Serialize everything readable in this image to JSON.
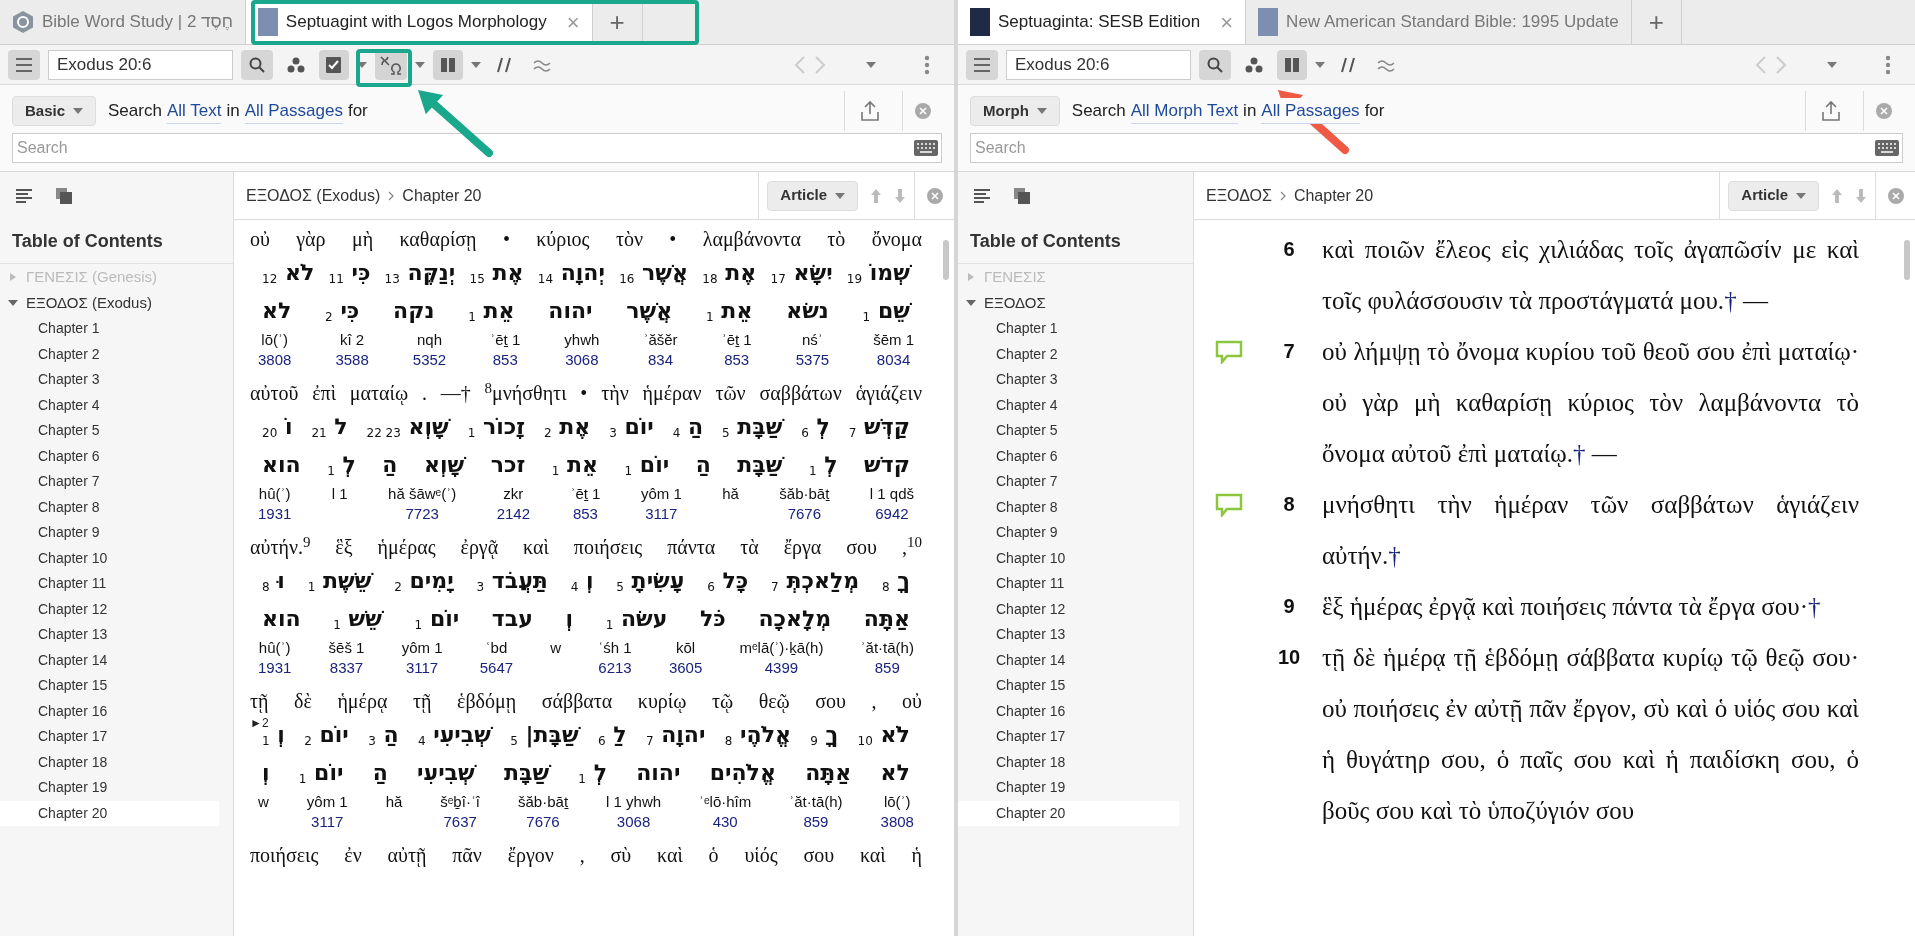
{
  "panes": [
    {
      "kind": "interlinear",
      "tabs": [
        {
          "kind": "home",
          "label": "Bible Word Study | 2 חֶסֶד",
          "selected": false
        },
        {
          "kind": "book",
          "label": "Septuagint with Logos Morphology",
          "selected": true,
          "close": "×"
        },
        {
          "kind": "add",
          "label": "+",
          "selected": false
        }
      ],
      "reference": "Exodus 20:6",
      "tools": [
        {
          "kind": "visual-filter",
          "on": false
        },
        {
          "kind": "highlight",
          "on": true
        },
        {
          "kind": "interlinear",
          "on": true
        },
        {
          "kind": "columns",
          "on": true
        },
        {
          "kind": "parallel",
          "on": false
        },
        {
          "kind": "inline",
          "on": false
        }
      ],
      "search": {
        "mode": "Basic",
        "prefix": "Search",
        "scope": "All Text",
        "joiner": "in",
        "range": "All Passages",
        "suffix": "for",
        "placeholder": "Search"
      },
      "toc": {
        "title": "Table of Contents",
        "books": [
          {
            "label": "ΓΕΝΕΣΙΣ (Genesis)",
            "expanded": false
          },
          {
            "label": "ΕΞΟΔΟΣ (Exodus)",
            "expanded": true,
            "children": [
              {
                "label": "Chapter 1",
                "selected": false
              },
              {
                "label": "Chapter 2",
                "selected": false
              },
              {
                "label": "Chapter 3",
                "selected": false
              },
              {
                "label": "Chapter 4",
                "selected": false
              },
              {
                "label": "Chapter 5",
                "selected": false
              },
              {
                "label": "Chapter 6",
                "selected": false
              },
              {
                "label": "Chapter 7",
                "selected": false
              },
              {
                "label": "Chapter 8",
                "selected": false
              },
              {
                "label": "Chapter 9",
                "selected": false
              },
              {
                "label": "Chapter 10",
                "selected": false
              },
              {
                "label": "Chapter 11",
                "selected": false
              },
              {
                "label": "Chapter 12",
                "selected": false
              },
              {
                "label": "Chapter 13",
                "selected": false
              },
              {
                "label": "Chapter 14",
                "selected": false
              },
              {
                "label": "Chapter 15",
                "selected": false
              },
              {
                "label": "Chapter 16",
                "selected": false
              },
              {
                "label": "Chapter 17",
                "selected": false
              },
              {
                "label": "Chapter 18",
                "selected": false
              },
              {
                "label": "Chapter 19",
                "selected": false
              },
              {
                "label": "Chapter 20",
                "selected": true
              }
            ]
          }
        ]
      },
      "breadcrumb": [
        "ΕΞΟΔΟΣ (Exodus)",
        "Chapter 20"
      ],
      "view_button": "Article",
      "blocks": [
        {
          "greek": [
            "οὐ",
            "γὰρ",
            "μὴ",
            "καθαρίσῃ",
            "•",
            "κύριος",
            "τὸν",
            "•",
            "λαμβάνοντα",
            "τὸ",
            "ὄνομα"
          ],
          "hebrew": [
            "שְׁמוֹ $_{19}$",
            "יִשָּׂא $_{17}$",
            "אֶת $_{18}$",
            "אֲשֶׁר $_{16}$",
            "יְהוָה $_{14}$",
            "אֶת $_{15}$",
            "יְנַקֶּה $_{13}$",
            "כִּי $_{11}$",
            "לֹא $_{12}$"
          ],
          "lemma": [
            "שֵׁם $_{1}$",
            "נשׂא",
            "אֵת $_{1}$",
            "אֲשֶׁר",
            "יהוה",
            "אֵת $_{1}$",
            "נקה",
            "כִּי $_{2}$",
            "לא"
          ],
          "words": [
            {
              "t": "lō(ʾ)",
              "s": "3808"
            },
            {
              "t": "kî 2",
              "s": "3588"
            },
            {
              "t": "nqh",
              "s": "5352"
            },
            {
              "t": "ʾēṯ 1",
              "s": "853"
            },
            {
              "t": "yhwh",
              "s": "3068"
            },
            {
              "t": "ʾăšĕr",
              "s": "834"
            },
            {
              "t": "ʾēṯ 1",
              "s": "853"
            },
            {
              "t": "nśʾ",
              "s": "5375"
            },
            {
              "t": "šēm 1",
              "s": "8034"
            }
          ]
        },
        {
          "greek": [
            "αὐτοῦ",
            "ἐπὶ",
            "ματαίῳ",
            ".",
            "—†",
            "$^{8}$μνήσθητι",
            "•",
            "τὴν",
            "ἡμέραν",
            "τῶν",
            "σαββάτων",
            "ἁγιάζειν"
          ],
          "hebrew": [
            "קַדְּשׁ $_{7}$",
            "לְ $_{6}$",
            "שַׁבָּת $_{5}$",
            "הַ $_{4}$",
            "יוֹם $_{3}$",
            "אֶת $_{2}$",
            "זָכוֹר $_{1}$",
            "שָׁוְא $_{23 22}$",
            "ל $_{21}$",
            "וֹ $_{20}$"
          ],
          "lemma": [
            "קדשׁ",
            "לְ $_{1}$",
            "שַׁבָּת",
            "הַ",
            "יוֹם $_{1}$",
            "אֵת $_{1}$",
            "זכר",
            "שָׁוְא",
            "הַ",
            "לְ $_{1}$",
            "הוא"
          ],
          "words": [
            {
              "t": "hû(ʾ)",
              "s": "1931"
            },
            {
              "t": "l 1"
            },
            {
              "t": "hă šāwᵉ(ʾ)",
              "s": "7723"
            },
            {
              "t": "zkr",
              "s": "2142"
            },
            {
              "t": "ʾēṯ 1",
              "s": "853"
            },
            {
              "t": "yôm 1",
              "s": "3117"
            },
            {
              "t": "hă"
            },
            {
              "t": "šăb·bāṯ",
              "s": "7676"
            },
            {
              "t": "l 1 qdš",
              "s": "6942"
            }
          ]
        },
        {
          "greek": [
            "αὐτήν.$^{9}$",
            "ἓξ",
            "ἡμέρας",
            "ἐργᾷ",
            "καὶ",
            "ποιήσεις",
            "πάντα",
            "τὰ",
            "ἔργα",
            "σου",
            ",$^{10}$"
          ],
          "hebrew": [
            "ךָ $_{8}$",
            "מְלַאכְתְּ $_{7}$",
            "כָּל $_{6}$",
            "עָשִׂיתָ $_{5}$",
            "וְ $_{4}$",
            "תַּעֲבֹד $_{3}$",
            "יָמִים $_{2}$",
            "שֵׁשֶׁת $_{1}$",
            "וּ $_{8}$"
          ],
          "lemma": [
            "אַתָּה",
            "מְלָאכָה",
            "כֹּל",
            "עשׂה $_{1}$",
            "וְ",
            "עבד",
            "יוֹם $_{1}$",
            "שֵׁשׁ $_{1}$",
            "הוא"
          ],
          "words": [
            {
              "t": "hû(ʾ)",
              "s": "1931"
            },
            {
              "t": "šēš 1",
              "s": "8337"
            },
            {
              "t": "yôm 1",
              "s": "3117"
            },
            {
              "t": "ʿbd",
              "s": "5647"
            },
            {
              "t": "w"
            },
            {
              "t": "ʿśh 1",
              "s": "6213"
            },
            {
              "t": "kōl",
              "s": "3605"
            },
            {
              "t": "mᵉlā(ʾ)·ḵā(h)",
              "s": "4399"
            },
            {
              "t": "ʾăt·tā(h)",
              "s": "859"
            }
          ]
        },
        {
          "marker": "►2",
          "greek": [
            "τῇ",
            "δὲ",
            "ἡμέρᾳ",
            "τῇ",
            "ἑβδόμῃ",
            "σάββατα",
            "κυρίῳ",
            "τῷ",
            "θεῷ",
            "σου",
            ",",
            "οὐ"
          ],
          "hebrew": [
            "לֹא $_{10}$",
            "ךָ $_{9}$",
            "אֱלֹהֶי $_{8}$",
            "יהוָה $_{7}$",
            "לַ $_{6}$",
            "שַׁבָּת| $_{5}$",
            "שְׁבִיעִי $_{4}$",
            "הַ $_{3}$",
            "יוֹם $_{2}$",
            "וְ $_{1}$"
          ],
          "lemma": [
            "לא",
            "אַתָּה",
            "אֱלֹהִים",
            "יהוה",
            "לְ $_{1}$",
            "שַׁבָּת",
            "שְׁבִיעִי",
            "הַ",
            "יוֹם $_{1}$",
            "וְ"
          ],
          "words": [
            {
              "t": "w"
            },
            {
              "t": "yôm 1",
              "s": "3117"
            },
            {
              "t": "hă"
            },
            {
              "t": "šᵉḇî·ʿî",
              "s": "7637"
            },
            {
              "t": "šăb·bāṯ",
              "s": "7676"
            },
            {
              "t": "l 1 yhwh",
              "s": "3068"
            },
            {
              "t": "ʾᵉlō·hîm",
              "s": "430"
            },
            {
              "t": "ʾăt·tā(h)",
              "s": "859"
            },
            {
              "t": "lō(ʾ)",
              "s": "3808"
            }
          ]
        },
        {
          "greek": [
            "ποιήσεις",
            "ἐν",
            "αὐτῇ",
            "πᾶν",
            "ἔργον",
            ",",
            "σὺ",
            "καὶ",
            "ὁ",
            "υἱός",
            "σου",
            "καὶ",
            "ἡ"
          ]
        }
      ]
    },
    {
      "kind": "reader",
      "tabs": [
        {
          "kind": "book",
          "label": "Septuaginta: SESB Edition",
          "selected": true,
          "close": "×"
        },
        {
          "kind": "book",
          "label": "New American Standard Bible: 1995 Update",
          "selected": false
        },
        {
          "kind": "add",
          "label": "+",
          "selected": false
        }
      ],
      "reference": "Exodus 20:6",
      "tools": [
        {
          "kind": "visual-filter",
          "on": false
        },
        {
          "kind": "columns",
          "on": true
        },
        {
          "kind": "parallel",
          "on": false
        },
        {
          "kind": "inline",
          "on": false
        }
      ],
      "search": {
        "mode": "Morph",
        "prefix": "Search",
        "scope": "All Morph Text",
        "joiner": "in",
        "range": "All Passages",
        "suffix": "for",
        "placeholder": "Search"
      },
      "toc": {
        "title": "Table of Contents",
        "books": [
          {
            "label": "ΓΕΝΕΣΙΣ",
            "expanded": false
          },
          {
            "label": "ΕΞΟΔΟΣ",
            "expanded": true,
            "children": [
              {
                "label": "Chapter 1",
                "selected": false
              },
              {
                "label": "Chapter 2",
                "selected": false
              },
              {
                "label": "Chapter 3",
                "selected": false
              },
              {
                "label": "Chapter 4",
                "selected": false
              },
              {
                "label": "Chapter 5",
                "selected": false
              },
              {
                "label": "Chapter 6",
                "selected": false
              },
              {
                "label": "Chapter 7",
                "selected": false
              },
              {
                "label": "Chapter 8",
                "selected": false
              },
              {
                "label": "Chapter 9",
                "selected": false
              },
              {
                "label": "Chapter 10",
                "selected": false
              },
              {
                "label": "Chapter 11",
                "selected": false
              },
              {
                "label": "Chapter 12",
                "selected": false
              },
              {
                "label": "Chapter 13",
                "selected": false
              },
              {
                "label": "Chapter 14",
                "selected": false
              },
              {
                "label": "Chapter 15",
                "selected": false
              },
              {
                "label": "Chapter 16",
                "selected": false
              },
              {
                "label": "Chapter 17",
                "selected": false
              },
              {
                "label": "Chapter 18",
                "selected": false
              },
              {
                "label": "Chapter 19",
                "selected": false
              },
              {
                "label": "Chapter 20",
                "selected": true
              }
            ]
          }
        ]
      },
      "breadcrumb": [
        "ΕΞΟΔΟΣ",
        "Chapter 20"
      ],
      "view_button": "Article",
      "verses": [
        {
          "num": "6",
          "comment": false,
          "text": "καὶ ποιῶν ἔλεος εἰς χιλιάδας τοῖς ἀγαπῶσίν με καὶ τοῖς φυλάσσουσιν τὰ προστάγματά μου.",
          "note": "†",
          "dash": "—"
        },
        {
          "num": "7",
          "comment": true,
          "text": "οὐ λήμψῃ τὸ ὄνομα κυρίου τοῦ θεοῦ σου ἐπὶ ματαίῳ· οὐ γὰρ μὴ καθαρίσῃ κύριος τὸν λαμβάνοντα τὸ ὄνομα αὐτοῦ ἐπὶ ματαίῳ.",
          "note": "†",
          "dash": "—"
        },
        {
          "num": "8",
          "comment": true,
          "text": "μνήσθητι τὴν ἡμέραν τῶν σαββάτων ἁγιάζειν αὐτήν.",
          "note": "†"
        },
        {
          "num": "9",
          "comment": false,
          "text": "ἓξ ἡμέρας ἐργᾷ καὶ ποιήσεις πάντα τὰ ἔργα σου·",
          "note": "†"
        },
        {
          "num": "10",
          "comment": false,
          "text": "τῇ δὲ ἡμέρᾳ τῇ ἑβδόμῃ σάββατα κυρίῳ τῷ θεῷ σου· οὐ ποιήσεις ἐν αὐτῇ πᾶν ἔργον, σὺ καὶ ὁ υἱός σου καὶ ἡ θυγάτηρ σου, ὁ παῖς σου καὶ ἡ παιδίσκη σου, ὁ βοῦς σου καὶ τὸ ὑποζύγιόν σου"
        }
      ]
    }
  ],
  "annotations": [
    {
      "kind": "box",
      "color": "#1aa88c"
    },
    {
      "kind": "box",
      "color": "#1aa88c"
    },
    {
      "kind": "arrow",
      "color": "#1aa88c"
    },
    {
      "kind": "arrow",
      "color": "#ef5a45"
    }
  ]
}
